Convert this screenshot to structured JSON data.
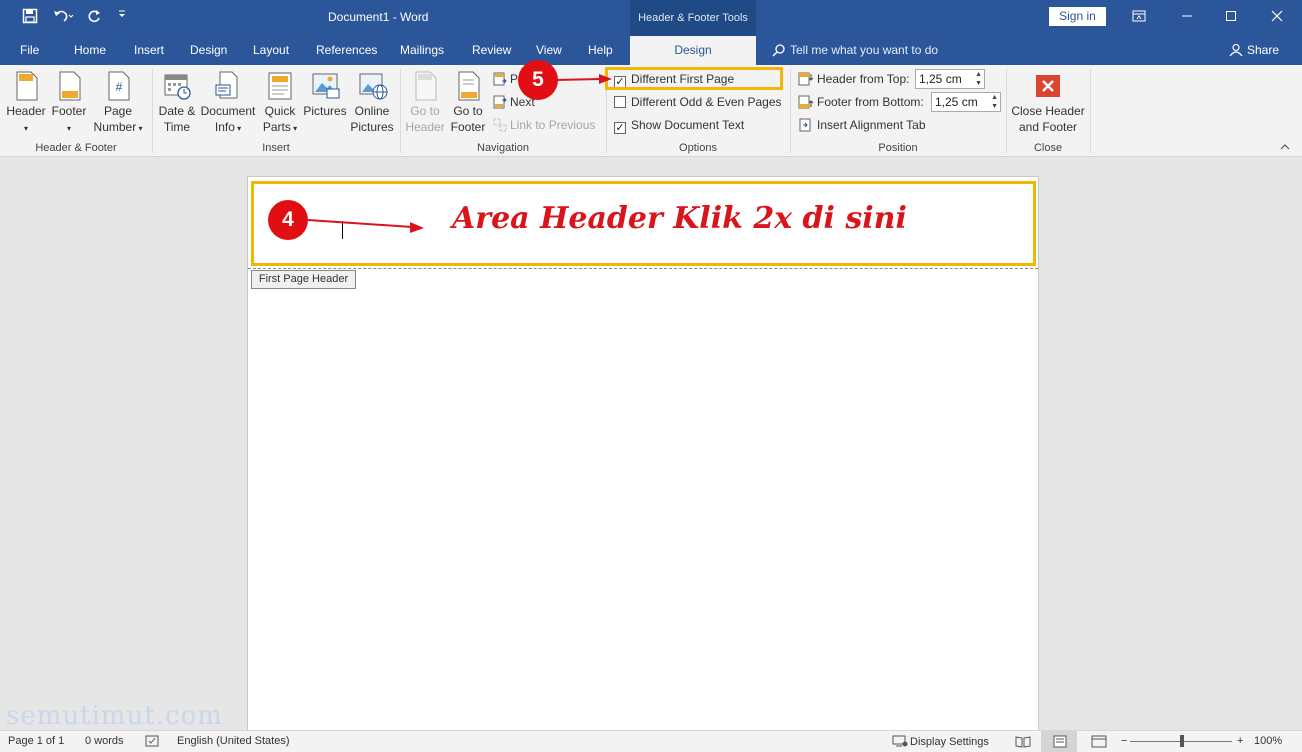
{
  "titlebar": {
    "save_icon": "save-icon",
    "undo_icon": "undo-icon",
    "redo_icon": "redo-icon",
    "customize_icon": "customize-qat-icon",
    "title": "Document1  -  Word",
    "context_tools": "Header & Footer Tools",
    "sign_in": "Sign in"
  },
  "tabs": {
    "file": "File",
    "home": "Home",
    "insert": "Insert",
    "design_main": "Design",
    "layout": "Layout",
    "references": "References",
    "mailings": "Mailings",
    "review": "Review",
    "view": "View",
    "help": "Help",
    "design_active": "Design",
    "tell_me": "Tell me what you want to do",
    "share": "Share"
  },
  "ribbon": {
    "header_footer": {
      "header": "Header",
      "footer": "Footer",
      "page_number_1": "Page",
      "page_number_2": "Number",
      "group": "Header & Footer"
    },
    "insert": {
      "date_1": "Date &",
      "date_2": "Time",
      "docinfo_1": "Document",
      "docinfo_2": "Info",
      "quickparts_1": "Quick",
      "quickparts_2": "Parts",
      "pictures": "Pictures",
      "online_1": "Online",
      "online_2": "Pictures",
      "group": "Insert"
    },
    "navigation": {
      "goto_header_1": "Go to",
      "goto_header_2": "Header",
      "goto_footer_1": "Go to",
      "goto_footer_2": "Footer",
      "previous": "P",
      "next": "Next",
      "link_previous": "Link to Previous",
      "group": "Navigation"
    },
    "options": {
      "different_first": "Different First Page",
      "different_first_checked": "✓",
      "odd_even": "Different Odd & Even Pages",
      "odd_even_checked": "",
      "show_doc_text": "Show Document Text",
      "show_doc_text_checked": "✓",
      "group": "Options"
    },
    "position": {
      "header_from_top": "Header from Top:",
      "header_value": "1,25 cm",
      "footer_from_bottom": "Footer from Bottom:",
      "footer_value": "1,25 cm",
      "insert_alignment_tab": "Insert Alignment Tab",
      "group": "Position"
    },
    "close": {
      "close_1": "Close Header",
      "close_2": "and Footer",
      "group": "Close"
    }
  },
  "document": {
    "annotation_text": "Area Header Klik 2x di sini",
    "first_page_header_tab": "First Page Header",
    "badge_4": "4",
    "badge_5": "5",
    "watermark": "semutimut.com"
  },
  "statusbar": {
    "page": "Page 1 of 1",
    "words": "0 words",
    "language": "English (United States)",
    "display_settings": "Display Settings",
    "zoom": "100%",
    "zoom_level": 1.0
  },
  "colors": {
    "brand": "#2b579a",
    "highlight": "#f2b705",
    "annotation": "#d9151b"
  }
}
